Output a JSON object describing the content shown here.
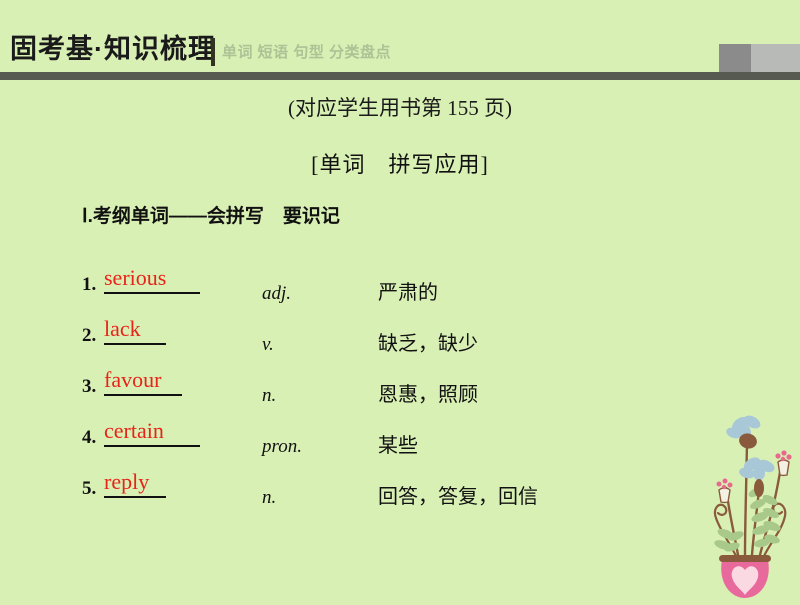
{
  "header": {
    "title": "固考基·知识梳理",
    "divider": "|",
    "subtitle": "单词 短语 句型 分类盘点",
    "accent_bar_color": "#565a51",
    "background_color": "#d9f0b5",
    "corner_block_dark_color": "#8b8b8b",
    "corner_block_light_color": "#b8bab8"
  },
  "page_ref": "(对应学生用书第 155 页)",
  "section_title": "[单词　拼写应用]",
  "subsection_title": "Ⅰ.考纲单词——会拼写　要识记",
  "word_list": [
    {
      "index": "1.",
      "word": "serious",
      "pos": "adj.",
      "meaning": "严肃的",
      "slot_width": "long"
    },
    {
      "index": "2.",
      "word": "lack",
      "pos": "v.",
      "meaning": "缺乏，缺少",
      "slot_width": "short"
    },
    {
      "index": "3.",
      "word": "favour",
      "pos": "n.",
      "meaning": "恩惠，照顾",
      "slot_width": "normal"
    },
    {
      "index": "4.",
      "word": "certain",
      "pos": "pron.",
      "meaning": "某些",
      "slot_width": "long"
    },
    {
      "index": "5.",
      "word": "reply",
      "pos": "n.",
      "meaning": "回答，答复，回信",
      "slot_width": "short"
    }
  ],
  "decoration": {
    "name": "flower-pot-illustration",
    "vase_color": "#e8699b",
    "vase_rim_color": "#8a5a3c",
    "heart_color": "#fbd9e2",
    "stem_color": "#8a5a3c",
    "leaf_color": "#a9c98a",
    "blue_petal_color": "#a8c8d8",
    "pink_blossom_color": "#e8698b"
  },
  "word_accent_color": "#e8241a",
  "text_color": "#111111"
}
